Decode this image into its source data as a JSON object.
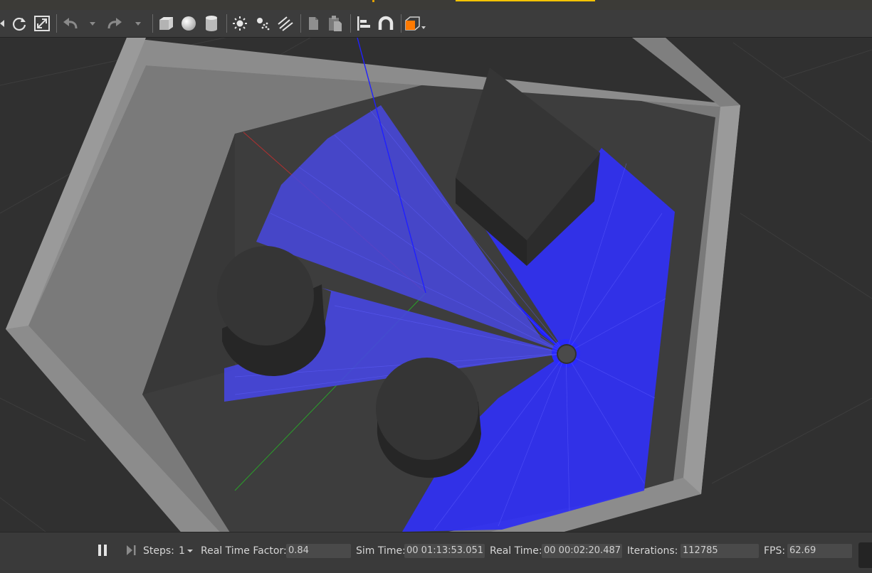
{
  "toolbar": {
    "icons": [
      "translate-mode-icon",
      "rotate-mode-icon",
      "scale-mode-icon",
      "undo-icon",
      "undo-dropdown-icon",
      "redo-icon",
      "redo-dropdown-icon",
      "box-shape-icon",
      "sphere-shape-icon",
      "cylinder-shape-icon",
      "point-light-icon",
      "spot-light-icon",
      "directional-light-icon",
      "copy-icon",
      "paste-icon",
      "align-icon",
      "snap-icon",
      "view-angle-icon"
    ],
    "accent_color": "#ff7a00"
  },
  "status": {
    "steps_label": "Steps:",
    "steps_value": "1",
    "rtf_label": "Real Time Factor:",
    "rtf_value": "0.84",
    "sim_time_label": "Sim Time:",
    "sim_time_value": "00 01:13:53.051",
    "real_time_label": "Real Time:",
    "real_time_value": "00 00:02:20.487",
    "iterations_label": "Iterations:",
    "iterations_value": "112785",
    "fps_label": "FPS:",
    "fps_value": "62.69"
  },
  "scene": {
    "laser_color": "#2a2aff",
    "wall_color": "#8c8c8c",
    "floor_color": "#3c3c3c",
    "obstacle_color": "#353535"
  }
}
